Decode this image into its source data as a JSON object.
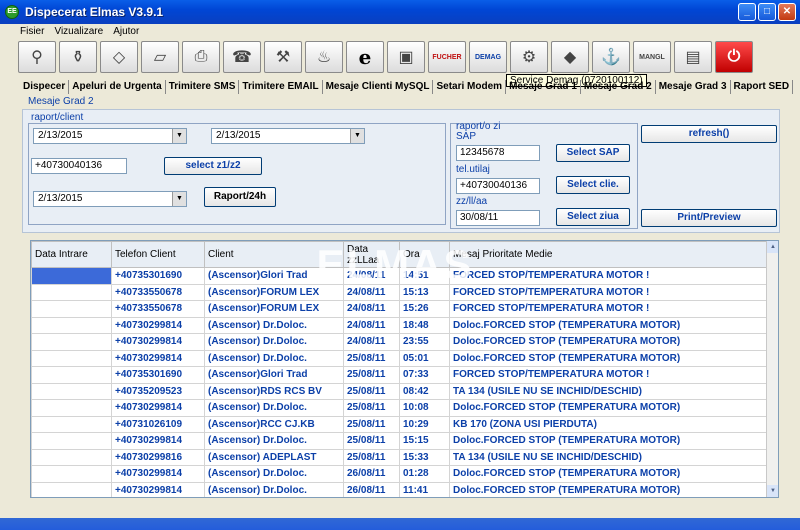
{
  "window": {
    "title": "Dispecerat Elmas V3.9.1"
  },
  "menu": [
    "Fisier",
    "Vizualizare",
    "Ajutor"
  ],
  "toolbar": {
    "e_label": "e",
    "fucher": "FUCHER",
    "demag": "DEMAG",
    "mangl": "MANGL"
  },
  "tooltip": "Service Demag (0720100112)",
  "tabs": [
    "Dispecer",
    "Apeluri de Urgenta",
    "Trimitere SMS",
    "Trimitere EMAIL",
    "Mesaje Clienti MySQL",
    "Setari Modem",
    "Mesaje Grad 1",
    "Mesaje Grad 2",
    "Mesaje Grad 3",
    "Raport SED"
  ],
  "section_title": "Mesaje Grad 2",
  "raport_client": {
    "label": "raport/client",
    "date_from": "2/13/2015",
    "date_to": "2/13/2015",
    "phone": "+40730040136",
    "select_button": "select z1/z2",
    "date_single": "2/13/2015",
    "report_button": "Raport/24h"
  },
  "raport_zi": {
    "label": "raport/o zi",
    "sap_label": "SAP",
    "sap_value": "12345678",
    "sap_button": "Select SAP",
    "tel_label": "tel.utilaj",
    "tel_value": "+40730040136",
    "tel_button": "Select clie.",
    "date_label": "zz/ll/aa",
    "date_value": "30/08/11",
    "date_button": "Select ziua"
  },
  "actions": {
    "refresh": "refresh()",
    "print": "Print/Preview"
  },
  "table": {
    "headers": [
      "Data Intrare",
      "Telefon Client",
      "Client",
      "Data zzLLaa",
      "Ora",
      "Mesaj Prioritate Medie"
    ],
    "rows": [
      [
        "",
        "+40735301690",
        "(Ascensor)Glori Trad",
        "24/08/11",
        "14:51",
        "FORCED STOP/TEMPERATURA MOTOR !"
      ],
      [
        "",
        "+40733550678",
        "(Ascensor)FORUM LEX",
        "24/08/11",
        "15:13",
        "FORCED STOP/TEMPERATURA MOTOR !"
      ],
      [
        "",
        "+40733550678",
        "(Ascensor)FORUM LEX",
        "24/08/11",
        "15:26",
        "FORCED STOP/TEMPERATURA MOTOR !"
      ],
      [
        "",
        "+40730299814",
        "(Ascensor) Dr.Doloc.",
        "24/08/11",
        "18:48",
        "Doloc.FORCED STOP (TEMPERATURA MOTOR)"
      ],
      [
        "",
        "+40730299814",
        "(Ascensor) Dr.Doloc.",
        "24/08/11",
        "23:55",
        "Doloc.FORCED STOP (TEMPERATURA MOTOR)"
      ],
      [
        "",
        "+40730299814",
        "(Ascensor) Dr.Doloc.",
        "25/08/11",
        "05:01",
        "Doloc.FORCED STOP (TEMPERATURA MOTOR)"
      ],
      [
        "",
        "+40735301690",
        "(Ascensor)Glori Trad",
        "25/08/11",
        "07:33",
        "FORCED STOP/TEMPERATURA MOTOR !"
      ],
      [
        "",
        "+40735209523",
        "(Ascensor)RDS RCS BV",
        "25/08/11",
        "08:42",
        "TA 134 (USILE NU SE INCHID/DESCHID)"
      ],
      [
        "",
        "+40730299814",
        "(Ascensor) Dr.Doloc.",
        "25/08/11",
        "10:08",
        "Doloc.FORCED STOP (TEMPERATURA MOTOR)"
      ],
      [
        "",
        "+40731026109",
        "(Ascensor)RCC CJ.KB",
        "25/08/11",
        "10:29",
        "KB 170 (ZONA USI PIERDUTA)"
      ],
      [
        "",
        "+40730299814",
        "(Ascensor) Dr.Doloc.",
        "25/08/11",
        "15:15",
        "Doloc.FORCED STOP (TEMPERATURA MOTOR)"
      ],
      [
        "",
        "+40730299816",
        "(Ascensor) ADEPLAST",
        "25/08/11",
        "15:33",
        "TA 134 (USILE NU SE INCHID/DESCHID)"
      ],
      [
        "",
        "+40730299814",
        "(Ascensor) Dr.Doloc.",
        "26/08/11",
        "01:28",
        "Doloc.FORCED STOP (TEMPERATURA MOTOR)"
      ],
      [
        "",
        "+40730299814",
        "(Ascensor) Dr.Doloc.",
        "26/08/11",
        "11:41",
        "Doloc.FORCED STOP (TEMPERATURA MOTOR)"
      ]
    ]
  },
  "watermark": "ELMAS"
}
